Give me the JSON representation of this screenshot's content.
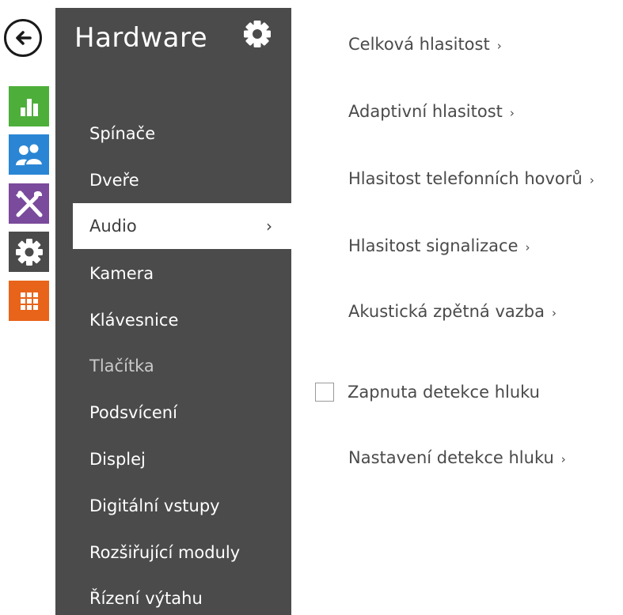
{
  "rail": {
    "back_icon": "arrow-left-icon",
    "items": [
      {
        "icon": "bar-chart-icon",
        "color": "#4daf3a"
      },
      {
        "icon": "users-icon",
        "color": "#2a86d4"
      },
      {
        "icon": "tools-icon",
        "color": "#7a4a9c"
      },
      {
        "icon": "gear-icon",
        "color": "#4b4b4b"
      },
      {
        "icon": "grid-icon",
        "color": "#e8641a"
      }
    ]
  },
  "sidebar": {
    "title": "Hardware",
    "title_icon": "gear-icon",
    "background": "#4b4b4b",
    "items": [
      {
        "label": "Spínače",
        "active": false
      },
      {
        "label": "Dveře",
        "active": false
      },
      {
        "label": "Audio",
        "active": true,
        "chevron": "›"
      },
      {
        "label": "Kamera",
        "active": false
      },
      {
        "label": "Klávesnice",
        "active": false
      },
      {
        "label": "Tlačítka",
        "active": false,
        "dimmed": true
      },
      {
        "label": "Podsvícení",
        "active": false
      },
      {
        "label": "Displej",
        "active": false
      },
      {
        "label": "Digitální vstupy",
        "active": false
      },
      {
        "label": "Rozšiřující moduly",
        "active": false
      },
      {
        "label": "Řízení výtahu",
        "active": false
      }
    ]
  },
  "main": {
    "links": [
      {
        "label": "Celková hlasitost",
        "chevron": "›"
      },
      {
        "label": "Adaptivní hlasitost",
        "chevron": "›"
      },
      {
        "label": "Hlasitost telefonních hovorů",
        "chevron": "›"
      },
      {
        "label": "Hlasitost signalizace",
        "chevron": "›"
      },
      {
        "label": "Akustická zpětná vazba",
        "chevron": "›"
      }
    ],
    "noise_detection": {
      "label": "Zapnuta detekce hluku",
      "checked": false
    },
    "noise_settings_link": {
      "label": "Nastavení detekce hluku",
      "chevron": "›"
    }
  }
}
